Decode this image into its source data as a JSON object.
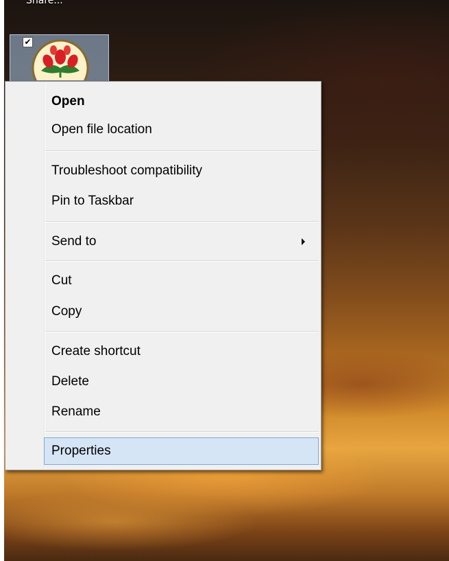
{
  "desktop": {
    "partial_label": "Share...",
    "icon_checked": true,
    "icon_name": "flower-app-icon"
  },
  "context_menu": {
    "items": [
      {
        "label": "Open",
        "bold": true
      },
      {
        "label": "Open file location"
      },
      {
        "label": "Troubleshoot compatibility"
      },
      {
        "label": "Pin to Taskbar"
      },
      {
        "label": "Send to",
        "has_submenu": true
      },
      {
        "label": "Cut"
      },
      {
        "label": "Copy"
      },
      {
        "label": "Create shortcut"
      },
      {
        "label": "Delete"
      },
      {
        "label": "Rename"
      },
      {
        "label": "Properties",
        "highlighted": true
      }
    ]
  },
  "colors": {
    "menu_background": "#f0f0f0",
    "highlight_background": "#d5e5f6",
    "highlight_border": "#7fa8d6"
  }
}
